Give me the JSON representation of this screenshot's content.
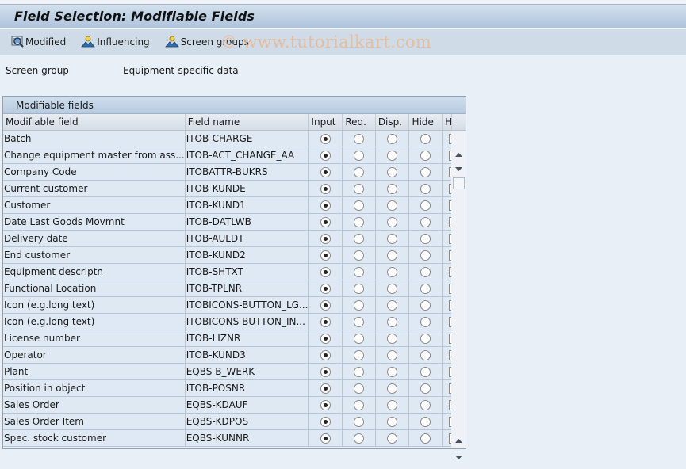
{
  "title": "Field Selection: Modifiable Fields",
  "toolbar": {
    "buttons": [
      {
        "label": "Modified",
        "icon": "display-icon"
      },
      {
        "label": "Influencing",
        "icon": "influencing-icon"
      },
      {
        "label": "Screen groups",
        "icon": "screen-groups-icon"
      }
    ],
    "watermark": "© www.tutorialkart.com"
  },
  "info": {
    "label": "Screen group",
    "value": "Equipment-specific data"
  },
  "table": {
    "title": "Modifiable fields",
    "columns": [
      "Modifiable field",
      "Field name",
      "Input",
      "Req.",
      "Disp.",
      "Hide",
      "HiLi"
    ],
    "rows": [
      {
        "field": "Batch",
        "name": "ITOB-CHARGE",
        "selected": "Input",
        "hili": false
      },
      {
        "field": "Change equipment master from ass...",
        "name": "ITOB-ACT_CHANGE_AA",
        "selected": "Input",
        "hili": false
      },
      {
        "field": "Company Code",
        "name": "ITOBATTR-BUKRS",
        "selected": "Input",
        "hili": false
      },
      {
        "field": "Current customer",
        "name": "ITOB-KUNDE",
        "selected": "Input",
        "hili": false
      },
      {
        "field": "Customer",
        "name": "ITOB-KUND1",
        "selected": "Input",
        "hili": false
      },
      {
        "field": "Date Last Goods Movmnt",
        "name": "ITOB-DATLWB",
        "selected": "Input",
        "hili": false
      },
      {
        "field": "Delivery date",
        "name": "ITOB-AULDT",
        "selected": "Input",
        "hili": false
      },
      {
        "field": "End customer",
        "name": "ITOB-KUND2",
        "selected": "Input",
        "hili": false
      },
      {
        "field": "Equipment descriptn",
        "name": "ITOB-SHTXT",
        "selected": "Input",
        "hili": false
      },
      {
        "field": "Functional Location",
        "name": "ITOB-TPLNR",
        "selected": "Input",
        "hili": false
      },
      {
        "field": "Icon (e.g.long text)",
        "name": "ITOBICONS-BUTTON_LG...",
        "selected": "Input",
        "hili": false
      },
      {
        "field": "Icon (e.g.long text)",
        "name": "ITOBICONS-BUTTON_IN...",
        "selected": "Input",
        "hili": false
      },
      {
        "field": "License number",
        "name": "ITOB-LIZNR",
        "selected": "Input",
        "hili": false
      },
      {
        "field": "Operator",
        "name": "ITOB-KUND3",
        "selected": "Input",
        "hili": false
      },
      {
        "field": "Plant",
        "name": "EQBS-B_WERK",
        "selected": "Input",
        "hili": false
      },
      {
        "field": "Position in object",
        "name": "ITOB-POSNR",
        "selected": "Input",
        "hili": false
      },
      {
        "field": "Sales Order",
        "name": "EQBS-KDAUF",
        "selected": "Input",
        "hili": false
      },
      {
        "field": "Sales Order Item",
        "name": "EQBS-KDPOS",
        "selected": "Input",
        "hili": false
      },
      {
        "field": "Spec. stock customer",
        "name": "EQBS-KUNNR",
        "selected": "Input",
        "hili": false
      }
    ]
  }
}
